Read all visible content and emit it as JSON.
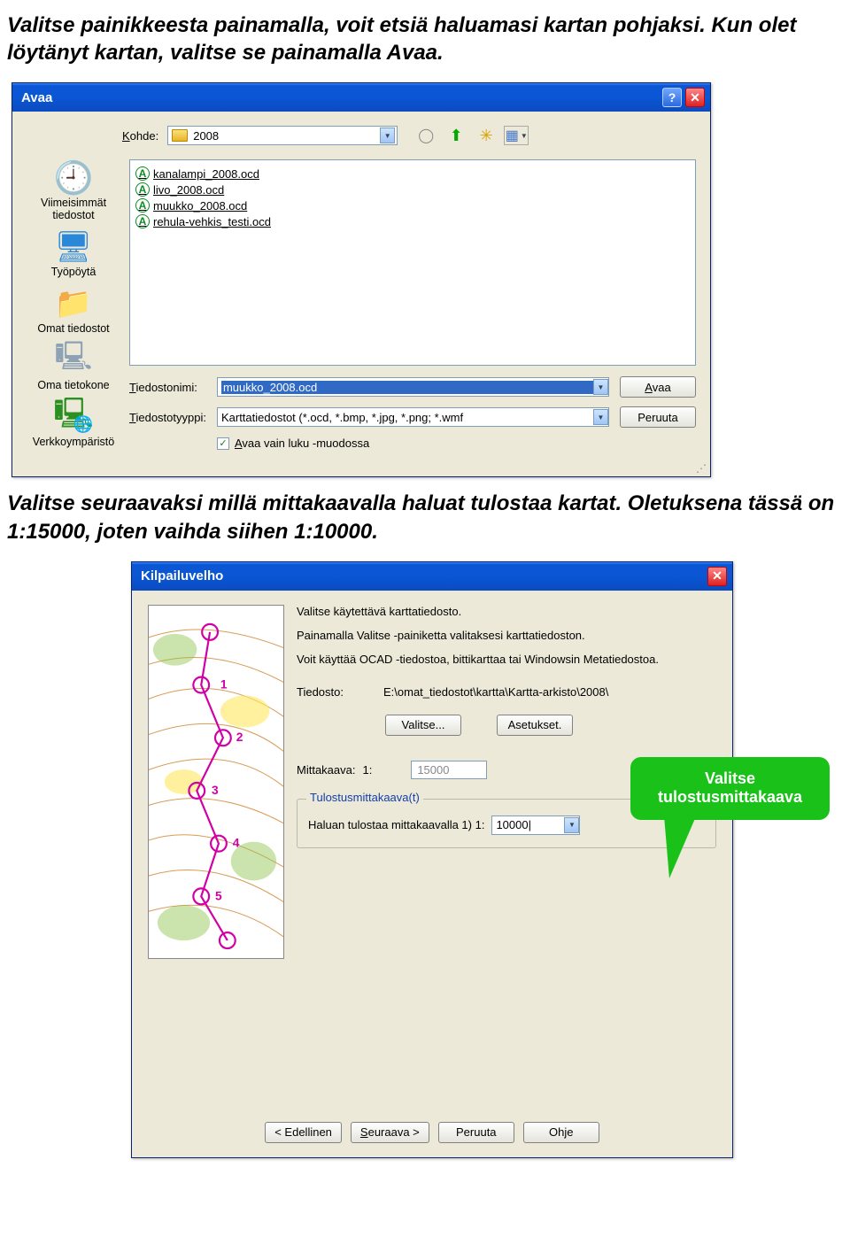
{
  "doc": {
    "p1": "Valitse painikkeesta painamalla, voit etsiä haluamasi kartan pohjaksi. Kun olet löytänyt kartan, valitse se painamalla Avaa.",
    "p2": "Valitse seuraavaksi millä mittakaavalla haluat tulostaa kartat. Oletuksena tässä on 1:15000, joten vaihda siihen 1:10000."
  },
  "openDialog": {
    "title": "Avaa",
    "lookInLabelPrefix": "K",
    "lookInLabelRest": "ohde:",
    "lookInValue": "2008",
    "places": {
      "recent": "Viimeisimmät tiedostot",
      "desktop": "Työpöytä",
      "mydocs": "Omat tiedostot",
      "mycomp": "Oma tietokone",
      "network": "Verkkoympäristö"
    },
    "files": [
      "kanalampi_2008.ocd",
      "livo_2008.ocd",
      "muukko_2008.ocd",
      "rehula-vehkis_testi.ocd"
    ],
    "filenameLabelPrefix": "T",
    "filenameLabelRest": "iedostonimi:",
    "filenameValue": "muukko_2008.ocd",
    "filetypeLabelPrefix": "T",
    "filetypeLabelRest": "iedostotyyppi:",
    "filetypeValue": "Karttatiedostot (*.ocd, *.bmp, *.jpg, *.png; *.wmf",
    "openBtnPrefix": "A",
    "openBtnRest": "vaa",
    "cancelBtn": "Peruuta",
    "readonlyPrefix": "A",
    "readonlyRest": "vaa vain luku -muodossa"
  },
  "wizard": {
    "title": "Kilpailuvelho",
    "line1": "Valitse käytettävä karttatiedosto.",
    "line2": "Painamalla Valitse -painiketta valitaksesi karttatiedoston.",
    "line3": "Voit käyttää OCAD -tiedostoa, bittikarttaa tai Windowsin Metatiedostoa.",
    "fileLabel": "Tiedosto:",
    "fileValue": "E:\\omat_tiedostot\\kartta\\Kartta-arkisto\\2008\\",
    "selectBtn": "Valitse...",
    "settingsBtn": "Asetukset.",
    "scaleLabel": "Mittakaava:",
    "scalePrefix": "1:",
    "scaleValue": "15000",
    "groupTitle": "Tulostusmittakaava(t)",
    "outScaleLabel": "Haluan tulostaa mittakaavalla 1) 1:",
    "outScaleValue": "10000|",
    "backBtnPrefix": "< E",
    "backBtnRest": "dellinen",
    "nextBtnPrefix": "S",
    "nextBtnRest": "euraava >",
    "cancelBtn": "Peruuta",
    "helpBtn": "Ohje"
  },
  "callout": {
    "line1": "Valitse",
    "line2": "tulostusmittakaava"
  }
}
